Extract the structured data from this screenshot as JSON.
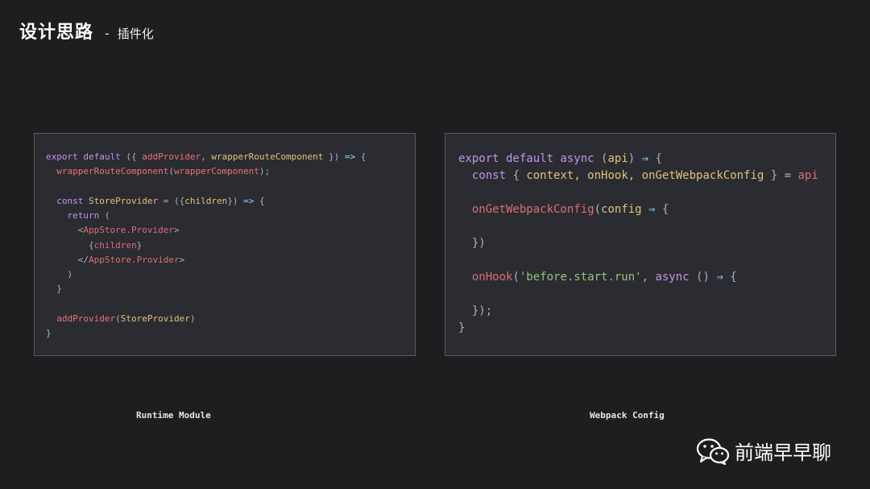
{
  "header": {
    "title": "设计思路",
    "separator": "-",
    "subtitle": "插件化"
  },
  "left_panel": {
    "lines": [
      [
        {
          "t": "export default",
          "c": "kw"
        },
        {
          "t": " ({ ",
          "c": "punc"
        },
        {
          "t": "addProvider",
          "c": "fn"
        },
        {
          "t": ", ",
          "c": "punc"
        },
        {
          "t": "wrapperRouteComponent",
          "c": "id"
        },
        {
          "t": " }) ",
          "c": "punc"
        },
        {
          "t": "=>",
          "c": "arrow"
        },
        {
          "t": " {",
          "c": "punc"
        }
      ],
      [
        {
          "t": "  ",
          "c": "plain"
        },
        {
          "t": "wrapperRouteComponent",
          "c": "fn"
        },
        {
          "t": "(",
          "c": "punc"
        },
        {
          "t": "wrapperComponent",
          "c": "fn"
        },
        {
          "t": ");",
          "c": "punc"
        }
      ],
      [
        {
          "t": "",
          "c": "plain"
        }
      ],
      [
        {
          "t": "  ",
          "c": "plain"
        },
        {
          "t": "const",
          "c": "kw"
        },
        {
          "t": " ",
          "c": "plain"
        },
        {
          "t": "StoreProvider",
          "c": "id"
        },
        {
          "t": " = ({",
          "c": "punc"
        },
        {
          "t": "children",
          "c": "id"
        },
        {
          "t": "}) ",
          "c": "punc"
        },
        {
          "t": "=>",
          "c": "arrow"
        },
        {
          "t": " {",
          "c": "punc"
        }
      ],
      [
        {
          "t": "    ",
          "c": "plain"
        },
        {
          "t": "return",
          "c": "kw"
        },
        {
          "t": " (",
          "c": "punc"
        }
      ],
      [
        {
          "t": "      <",
          "c": "punc"
        },
        {
          "t": "AppStore.Provider",
          "c": "tag"
        },
        {
          "t": ">",
          "c": "punc"
        }
      ],
      [
        {
          "t": "        {",
          "c": "punc"
        },
        {
          "t": "children",
          "c": "tag"
        },
        {
          "t": "}",
          "c": "punc"
        }
      ],
      [
        {
          "t": "      </",
          "c": "punc"
        },
        {
          "t": "AppStore.Provider",
          "c": "tag"
        },
        {
          "t": ">",
          "c": "punc"
        }
      ],
      [
        {
          "t": "    )",
          "c": "punc"
        }
      ],
      [
        {
          "t": "  }",
          "c": "punc"
        }
      ],
      [
        {
          "t": "",
          "c": "plain"
        }
      ],
      [
        {
          "t": "  ",
          "c": "plain"
        },
        {
          "t": "addProvider",
          "c": "fn"
        },
        {
          "t": "(",
          "c": "punc"
        },
        {
          "t": "StoreProvider",
          "c": "id"
        },
        {
          "t": ")",
          "c": "punc"
        }
      ],
      [
        {
          "t": "}",
          "c": "punc"
        }
      ]
    ]
  },
  "right_panel": {
    "lines": [
      [
        {
          "t": "export default async",
          "c": "kw"
        },
        {
          "t": " (",
          "c": "punc"
        },
        {
          "t": "api",
          "c": "id"
        },
        {
          "t": ") ",
          "c": "punc"
        },
        {
          "t": "⇒",
          "c": "arrow"
        },
        {
          "t": " {",
          "c": "punc"
        }
      ],
      [
        {
          "t": "  ",
          "c": "plain"
        },
        {
          "t": "const",
          "c": "kw"
        },
        {
          "t": " { ",
          "c": "punc"
        },
        {
          "t": "context, onHook, onGetWebpackConfig",
          "c": "id"
        },
        {
          "t": " } = ",
          "c": "punc"
        },
        {
          "t": "api",
          "c": "fn2"
        }
      ],
      [
        {
          "t": "",
          "c": "plain"
        }
      ],
      [
        {
          "t": "  ",
          "c": "plain"
        },
        {
          "t": "onGetWebpackConfig",
          "c": "fn2"
        },
        {
          "t": "(",
          "c": "punc"
        },
        {
          "t": "config",
          "c": "id"
        },
        {
          "t": " ",
          "c": "plain"
        },
        {
          "t": "⇒",
          "c": "arrow"
        },
        {
          "t": " {",
          "c": "punc"
        }
      ],
      [
        {
          "t": "",
          "c": "plain"
        }
      ],
      [
        {
          "t": "  })",
          "c": "punc"
        }
      ],
      [
        {
          "t": "",
          "c": "plain"
        }
      ],
      [
        {
          "t": "  ",
          "c": "plain"
        },
        {
          "t": "onHook",
          "c": "fn2"
        },
        {
          "t": "(",
          "c": "punc"
        },
        {
          "t": "'before.start.run'",
          "c": "str"
        },
        {
          "t": ", ",
          "c": "punc"
        },
        {
          "t": "async",
          "c": "kw"
        },
        {
          "t": " () ",
          "c": "punc"
        },
        {
          "t": "⇒",
          "c": "arrow"
        },
        {
          "t": " {",
          "c": "punc"
        }
      ],
      [
        {
          "t": "",
          "c": "plain"
        }
      ],
      [
        {
          "t": "  });",
          "c": "punc"
        }
      ],
      [
        {
          "t": "}",
          "c": "punc"
        }
      ]
    ]
  },
  "captions": {
    "left": "Runtime Module",
    "right": "Webpack Config"
  },
  "brand": {
    "icon": "wechat-icon",
    "name": "前端早早聊"
  }
}
